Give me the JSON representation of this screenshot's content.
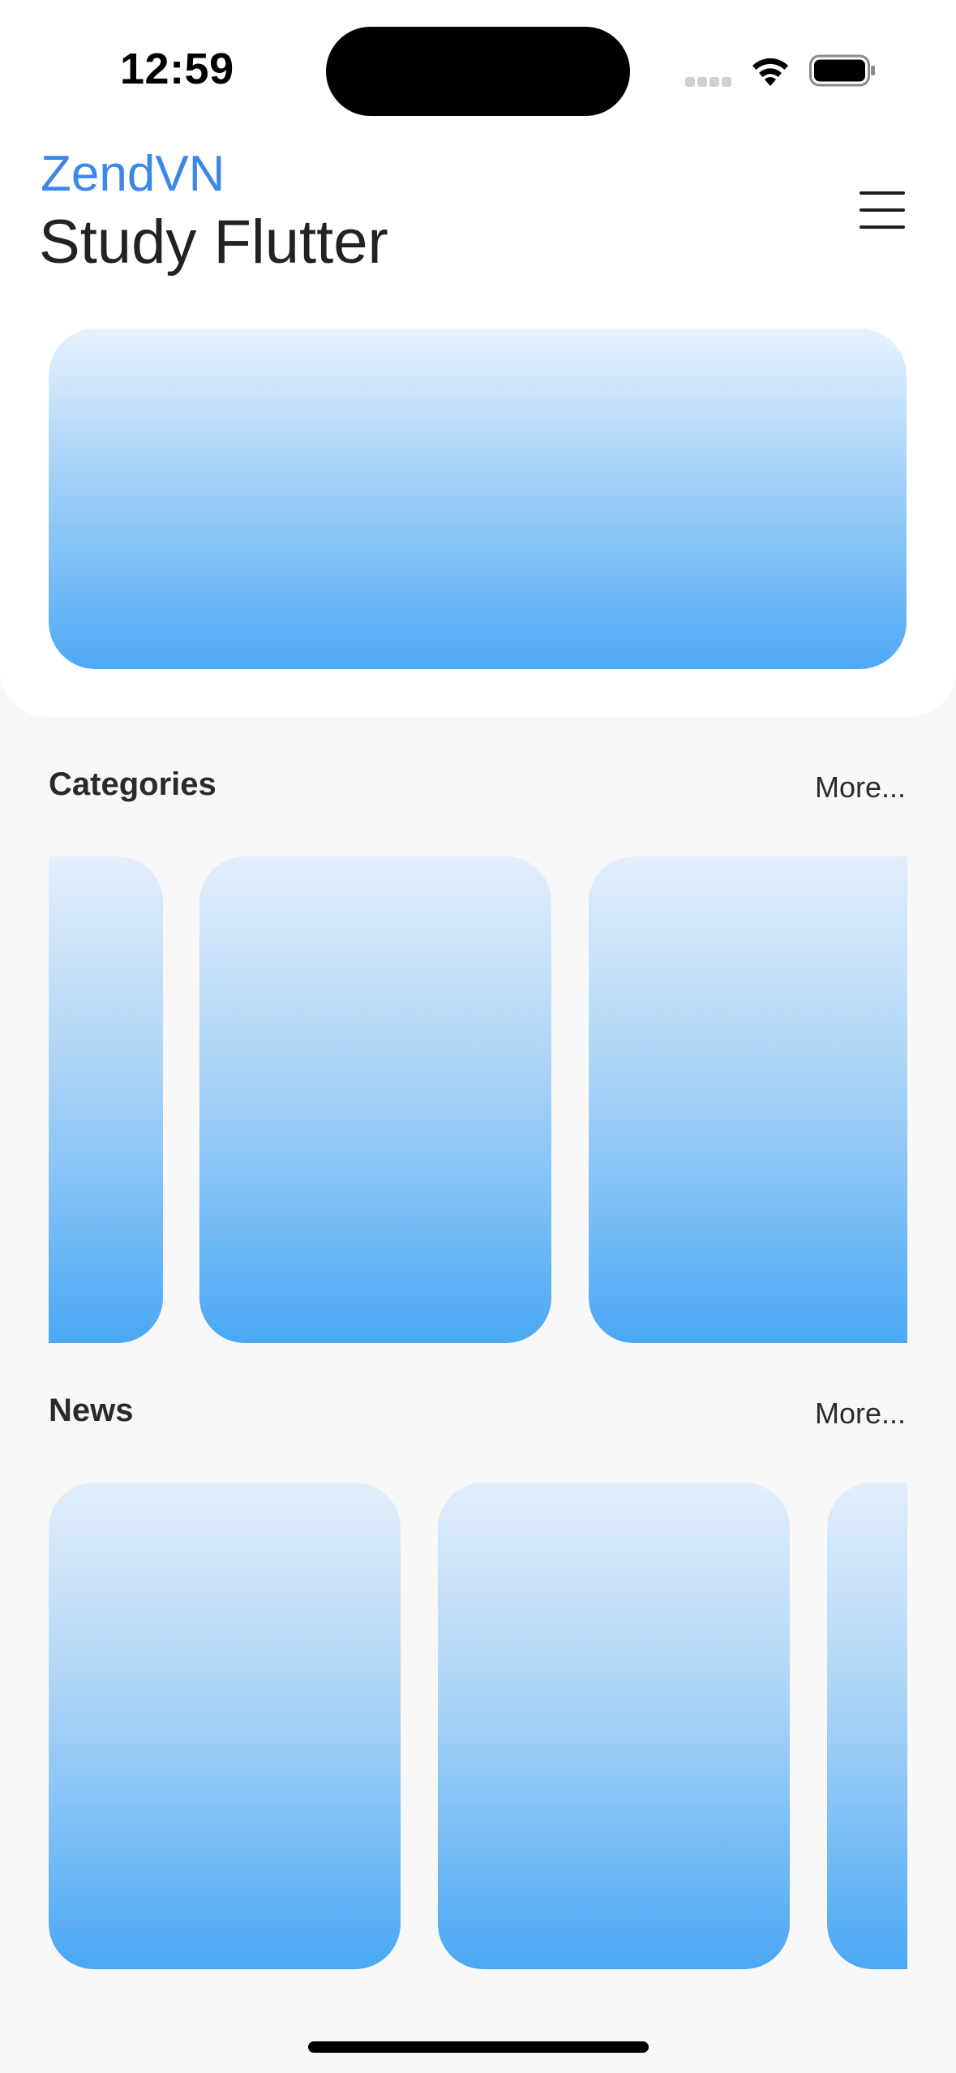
{
  "status_bar": {
    "time": "12:59"
  },
  "header": {
    "brand": "ZendVN",
    "title": "Study Flutter",
    "menu_icon": "hamburger-menu-icon"
  },
  "sections": {
    "categories": {
      "title": "Categories",
      "more_label": "More..."
    },
    "news": {
      "title": "News",
      "more_label": "More..."
    }
  },
  "colors": {
    "brand": "#3b86e9",
    "card_gradient_top": "#e2eefb",
    "card_gradient_bottom": "#4aa8f5",
    "background": "#f8f8f8"
  }
}
